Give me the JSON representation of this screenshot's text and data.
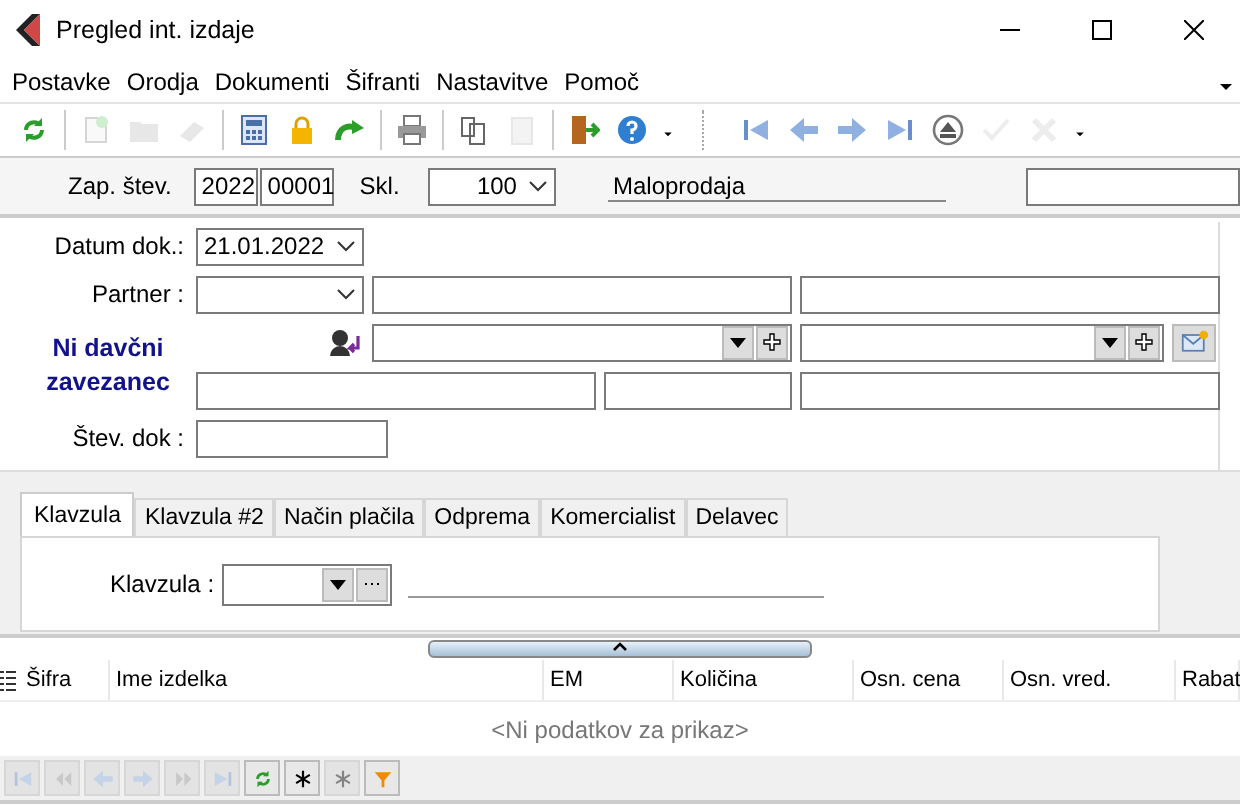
{
  "window": {
    "title": "Pregled int. izdaje"
  },
  "menu": [
    "Postavke",
    "Orodja",
    "Dokumenti",
    "Šifranti",
    "Nastavitve",
    "Pomoč"
  ],
  "toolbar": [
    {
      "kind": "refresh",
      "disabled": false
    },
    {
      "kind": "sep"
    },
    {
      "kind": "new",
      "disabled": true
    },
    {
      "kind": "folder",
      "disabled": true
    },
    {
      "kind": "eraser",
      "disabled": true
    },
    {
      "kind": "sep"
    },
    {
      "kind": "calculator",
      "disabled": false
    },
    {
      "kind": "lock",
      "disabled": false
    },
    {
      "kind": "redo",
      "disabled": false
    },
    {
      "kind": "sep"
    },
    {
      "kind": "print",
      "disabled": false
    },
    {
      "kind": "sep"
    },
    {
      "kind": "copy",
      "disabled": false
    },
    {
      "kind": "paste",
      "disabled": true
    },
    {
      "kind": "sep"
    },
    {
      "kind": "exit",
      "disabled": false
    },
    {
      "kind": "help",
      "disabled": false
    },
    {
      "kind": "caret",
      "disabled": false
    },
    {
      "kind": "gap"
    },
    {
      "kind": "first",
      "disabled": false
    },
    {
      "kind": "prev",
      "disabled": false
    },
    {
      "kind": "next",
      "disabled": false
    },
    {
      "kind": "last",
      "disabled": false
    },
    {
      "kind": "eject",
      "disabled": false
    },
    {
      "kind": "check",
      "disabled": true
    },
    {
      "kind": "cancel",
      "disabled": true
    },
    {
      "kind": "caret",
      "disabled": false
    }
  ],
  "header": {
    "label": "Zap. štev.",
    "year": "2022",
    "number": "00001",
    "warehouse_label": "Skl.",
    "warehouse": "100",
    "warehouse_name": "Maloprodaja"
  },
  "form": {
    "date_label": "Datum dok.:",
    "date": "21.01.2022",
    "partner_label": "Partner :",
    "tax_status": "Ni davčni zavezanec",
    "doc_number_label": "Štev. dok :"
  },
  "tabs": [
    {
      "label": "Klavzula",
      "selected": true
    },
    {
      "label": "Klavzula #2",
      "selected": false
    },
    {
      "label": "Način plačila",
      "selected": false
    },
    {
      "label": "Odprema",
      "selected": false
    },
    {
      "label": "Komercialist",
      "selected": false
    },
    {
      "label": "Delavec",
      "selected": false
    }
  ],
  "clause": {
    "label": "Klavzula :"
  },
  "table": {
    "columns": [
      "Šifra",
      "Ime izdelka",
      "EM",
      "Količina",
      "Osn. cena",
      "Osn. vred.",
      "Rabat"
    ],
    "empty_message": "<Ni podatkov za prikaz>"
  },
  "navigator": [
    {
      "kind": "first",
      "disabled": true
    },
    {
      "kind": "prevpage",
      "disabled": true
    },
    {
      "kind": "prev",
      "disabled": true
    },
    {
      "kind": "next",
      "disabled": true
    },
    {
      "kind": "nextpage",
      "disabled": true
    },
    {
      "kind": "last",
      "disabled": true
    },
    {
      "kind": "refresh",
      "disabled": false
    },
    {
      "kind": "star",
      "disabled": false
    },
    {
      "kind": "star",
      "disabled": true
    },
    {
      "kind": "filter",
      "disabled": false
    }
  ]
}
